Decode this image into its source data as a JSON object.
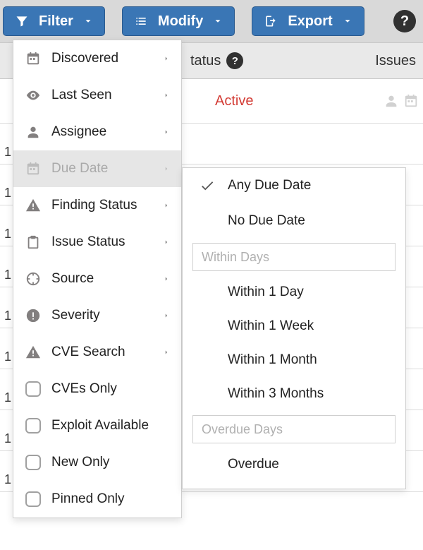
{
  "toolbar": {
    "filter_label": "Filter",
    "modify_label": "Modify",
    "export_label": "Export"
  },
  "header": {
    "status_label": "tatus",
    "issues_label": "Issues"
  },
  "status_row": {
    "active_label": "Active"
  },
  "left_truncated_marks": [
    "1",
    "1",
    "1",
    "1",
    "1",
    "1",
    "1",
    "1",
    "1"
  ],
  "filter_menu": {
    "items": [
      {
        "label": "Discovered",
        "icon": "calendar-icon",
        "submenu": true
      },
      {
        "label": "Last Seen",
        "icon": "eye-icon",
        "submenu": true
      },
      {
        "label": "Assignee",
        "icon": "person-icon",
        "submenu": true
      },
      {
        "label": "Due Date",
        "icon": "calendar-icon",
        "submenu": true,
        "selected": true
      },
      {
        "label": "Finding Status",
        "icon": "warning-icon",
        "submenu": true
      },
      {
        "label": "Issue Status",
        "icon": "clipboard-icon",
        "submenu": true
      },
      {
        "label": "Source",
        "icon": "crosshair-icon",
        "submenu": true
      },
      {
        "label": "Severity",
        "icon": "exclaim-circle-icon",
        "submenu": true
      },
      {
        "label": "CVE Search",
        "icon": "warning-icon",
        "submenu": true
      },
      {
        "label": "CVEs Only",
        "icon": "checkbox",
        "submenu": false
      },
      {
        "label": "Exploit Available",
        "icon": "checkbox",
        "submenu": false
      },
      {
        "label": "New Only",
        "icon": "checkbox",
        "submenu": false
      },
      {
        "label": "Pinned Only",
        "icon": "checkbox",
        "submenu": false
      }
    ]
  },
  "due_date_submenu": {
    "any_label": "Any Due Date",
    "none_label": "No Due Date",
    "within_placeholder": "Within Days",
    "within_options": [
      "Within 1 Day",
      "Within 1 Week",
      "Within 1 Month",
      "Within 3 Months"
    ],
    "overdue_placeholder": "Overdue Days",
    "overdue_label": "Overdue"
  },
  "colors": {
    "button_bg": "#3a76b5",
    "active_text": "#d33b34"
  }
}
